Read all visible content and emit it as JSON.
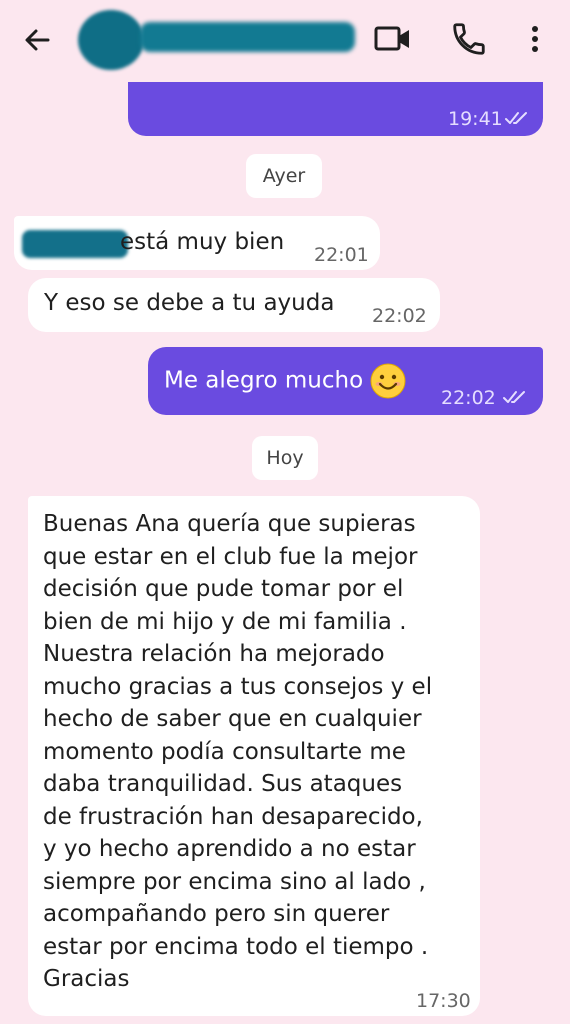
{
  "header": {
    "back_icon": "arrow-left-icon",
    "video_icon": "video-camera-icon",
    "call_icon": "phone-icon",
    "more_icon": "more-vertical-icon"
  },
  "messages": {
    "top_partial": {
      "time": "19:41"
    },
    "day_ayer": "Ayer",
    "msg1": {
      "text": "está muy bien",
      "time": "22:01"
    },
    "msg2": {
      "text": "Y eso se debe a tu ayuda",
      "time": "22:02"
    },
    "msg3": {
      "text": "Me alegro mucho",
      "time": "22:02",
      "emoji": "smiling-face-icon"
    },
    "day_hoy": "Hoy",
    "msg4": {
      "lines": [
        "Buenas Ana quería que supieras",
        "que estar en el club fue la mejor",
        "decisión que pude tomar por el",
        "bien de mi hijo y de mi familia .",
        "Nuestra relación ha mejorado",
        "mucho gracias a tus consejos y el",
        "hecho de saber que en cualquier",
        "momento podía consultarte me",
        "daba tranquilidad. Sus ataques",
        "de frustración han desaparecido,",
        "y yo hecho aprendido a no estar",
        "siempre por encima sino al lado ,",
        "acompañando pero sin querer",
        "estar por encima todo el tiempo .",
        "Gracias"
      ],
      "time": "17:30"
    }
  },
  "colors": {
    "background": "#fce7ef",
    "outgoing_bubble": "#6a4be0",
    "incoming_bubble": "#ffffff"
  }
}
